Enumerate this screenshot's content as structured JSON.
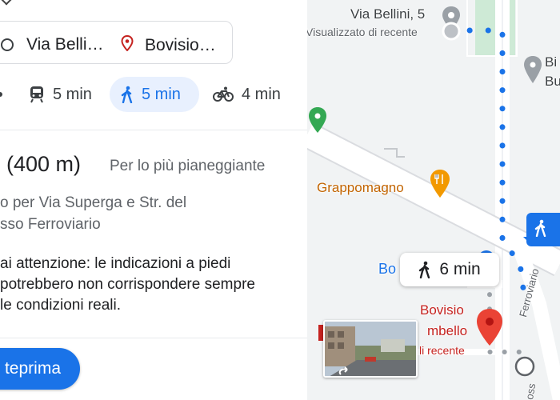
{
  "panel": {
    "origin": "Via Belli…",
    "destination": "Bovisio…",
    "modes": [
      {
        "icon": "train-icon",
        "label": "5 min"
      },
      {
        "icon": "walk-icon",
        "label": "5 min",
        "selected": true
      },
      {
        "icon": "bike-icon",
        "label": "4 min"
      }
    ],
    "distance": "(400 m)",
    "flat_note": "Per lo più pianeggiante",
    "via": "o per Via Superga e Str. del\nsso Ferroviario",
    "warning": "ai attenzione: le indicazioni a piedi\npotrebbero non corrispondere sempre\nle condizioni reali.",
    "preview_button": "teprima"
  },
  "map": {
    "labels": {
      "bellini": "Via Bellini, 5",
      "visualizzato": "Visualizzato di recente",
      "bi1": "Bi",
      "bi2": "Bu",
      "grappomagno": "Grappomagno",
      "bo": "Bo",
      "bovisio": "Bovisio",
      "mbello": "mbello",
      "recente": "li recente",
      "ferroviario": "Ferroviario",
      "passo": "oss"
    },
    "walk_chip": "6 min",
    "route_color": "#1a73e8",
    "destination_pin_color": "#ea4335",
    "restaurant_color": "#f29900",
    "park_pin_color": "#34a853"
  }
}
